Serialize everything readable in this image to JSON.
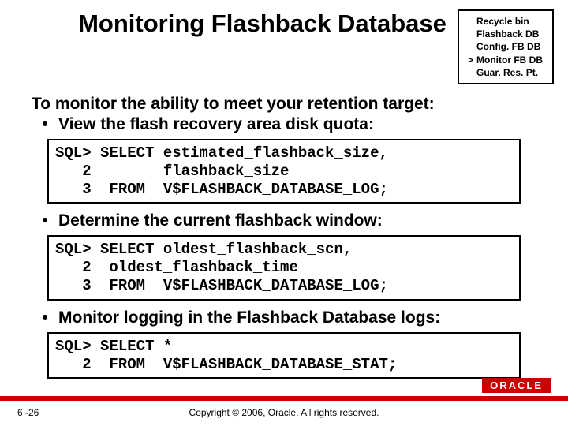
{
  "title": "Monitoring Flashback Database",
  "nav": {
    "items": [
      {
        "mark": "",
        "text": "Recycle bin"
      },
      {
        "mark": "",
        "text": "Flashback DB"
      },
      {
        "mark": "",
        "text": "Config. FB DB"
      },
      {
        "mark": ">",
        "text": "Monitor FB DB"
      },
      {
        "mark": "",
        "text": "Guar. Res. Pt."
      }
    ]
  },
  "lead": "To monitor the ability to meet your retention target:",
  "bullets": [
    "View the flash recovery area disk quota:",
    "Determine the current flashback window:",
    "Monitor logging in the Flashback Database logs:"
  ],
  "sql": [
    "SQL> SELECT estimated_flashback_size,\n   2        flashback_size\n   3  FROM  V$FLASHBACK_DATABASE_LOG;",
    "SQL> SELECT oldest_flashback_scn,\n   2  oldest_flashback_time\n   3  FROM  V$FLASHBACK_DATABASE_LOG;",
    "SQL> SELECT *\n   2  FROM  V$FLASHBACK_DATABASE_STAT;"
  ],
  "pageNum": "6 -26",
  "copyright": "Copyright © 2006, Oracle. All rights reserved.",
  "logo": "ORACLE"
}
